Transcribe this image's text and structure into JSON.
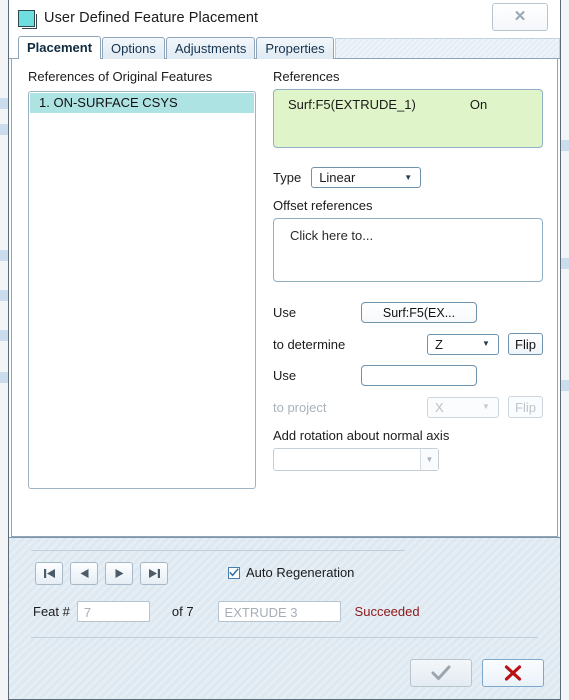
{
  "window": {
    "title": "User Defined Feature Placement",
    "icon": "feature-cube-icon",
    "close_glyph": "✕"
  },
  "tabs": [
    {
      "label": "Placement",
      "active": true
    },
    {
      "label": "Options",
      "active": false
    },
    {
      "label": "Adjustments",
      "active": false
    },
    {
      "label": "Properties",
      "active": false
    }
  ],
  "left_pane": {
    "label": "References of Original Features",
    "items": [
      {
        "text": "1. ON-SURFACE CSYS",
        "selected": true
      }
    ]
  },
  "right_pane": {
    "references_label": "References",
    "reference_row": {
      "name": "Surf:F5(EXTRUDE_1)",
      "state": "On"
    },
    "type_label": "Type",
    "type_value": "Linear",
    "offset_label": "Offset references",
    "offset_placeholder": "Click here to...",
    "use_label_1": "Use",
    "use_button_1": "Surf:F5(EX...",
    "determine_label": "to determine",
    "determine_axis": "Z",
    "determine_flip": "Flip",
    "use_label_2": "Use",
    "use_field_2": "",
    "project_label": "to project",
    "project_axis": "X",
    "project_flip": "Flip",
    "rotation_label": "Add rotation about normal axis",
    "rotation_value": ""
  },
  "bottom_panel": {
    "nav": [
      {
        "name": "first",
        "label": "|◀"
      },
      {
        "name": "previous",
        "label": "◀"
      },
      {
        "name": "next",
        "label": "▶"
      },
      {
        "name": "last",
        "label": "▶|"
      }
    ],
    "auto_regeneration_label": "Auto Regeneration",
    "auto_regeneration_checked": true,
    "feat_label": "Feat #",
    "feat_number": "7",
    "feat_of": "of 7",
    "feat_name": "EXTRUDE 3",
    "feat_status": "Succeeded",
    "status_color": "#8e1717"
  },
  "actions": {
    "ok_label": "✓",
    "cancel_label": "✕"
  }
}
